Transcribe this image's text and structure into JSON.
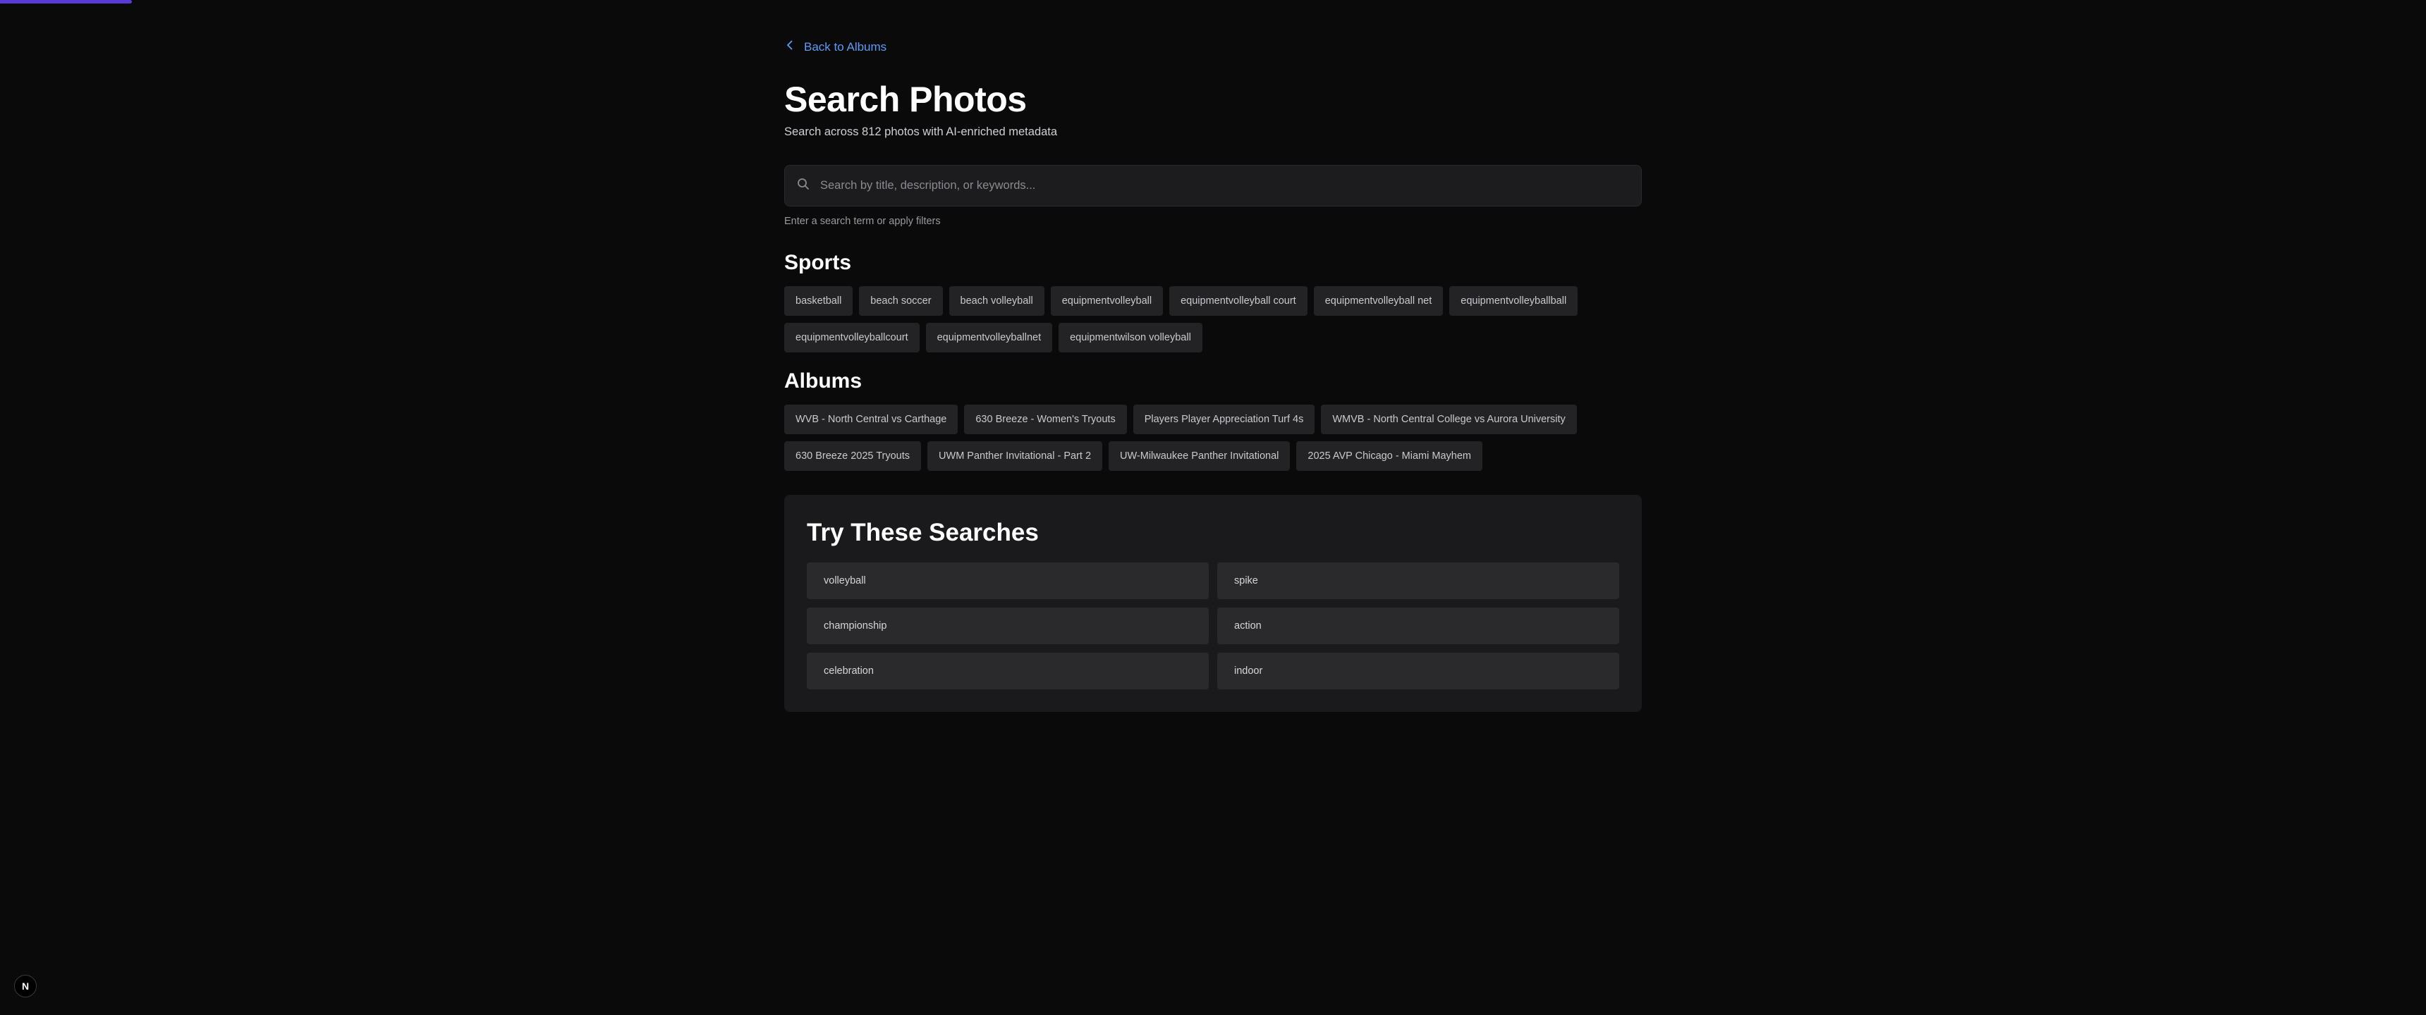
{
  "progress": {
    "fraction": 0.0545,
    "color": "#5b3bd6"
  },
  "nav": {
    "back_label": "Back to Albums"
  },
  "header": {
    "title": "Search Photos",
    "subtitle": "Search across 812 photos with AI-enriched metadata"
  },
  "search": {
    "placeholder": "Search by title, description, or keywords...",
    "value": "",
    "hint": "Enter a search term or apply filters"
  },
  "sports": {
    "title": "Sports",
    "tags": [
      "basketball",
      "beach soccer",
      "beach volleyball",
      "equipmentvolleyball",
      "equipmentvolleyball court",
      "equipmentvolleyball net",
      "equipmentvolleyballball",
      "equipmentvolleyballcourt",
      "equipmentvolleyballnet",
      "equipmentwilson volleyball"
    ]
  },
  "albums": {
    "title": "Albums",
    "tags": [
      "WVB - North Central vs Carthage",
      "630 Breeze - Women's Tryouts",
      "Players Player Appreciation Turf 4s",
      "WMVB - North Central College vs Aurora University",
      "630 Breeze 2025 Tryouts",
      "UWM Panther Invitational - Part 2",
      "UW-Milwaukee Panther Invitational",
      "2025 AVP Chicago - Miami Mayhem"
    ]
  },
  "suggestions": {
    "title": "Try These Searches",
    "items": [
      "volleyball",
      "spike",
      "championship",
      "action",
      "celebration",
      "indoor"
    ]
  },
  "badge": {
    "label": "N"
  },
  "colors": {
    "accent": "#5b9cf5",
    "background": "#0a0a0b",
    "panel": "#1a1a1c"
  }
}
